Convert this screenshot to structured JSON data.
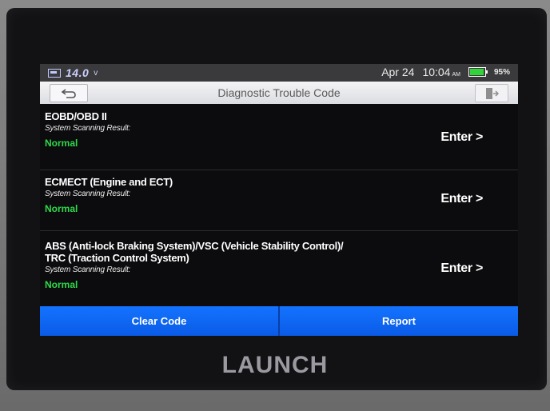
{
  "status_bar": {
    "voltage": "14.0",
    "voltage_unit": "v",
    "date": "Apr 24",
    "time": "10:04",
    "ampm": "AM",
    "battery_percent": "95%",
    "battery_color": "#33d33a"
  },
  "header": {
    "title": "Diagnostic Trouble Code",
    "back_icon": "back-arrow-icon",
    "exit_icon": "exit-door-icon"
  },
  "systems": [
    {
      "name_lines": [
        "EOBD/OBD II"
      ],
      "scan_label": "System Scanning Result:",
      "result": "Normal",
      "action": "Enter >"
    },
    {
      "name_lines": [
        "ECMECT (Engine and ECT)"
      ],
      "scan_label": "System Scanning Result:",
      "result": "Normal",
      "action": "Enter >"
    },
    {
      "name_lines": [
        "ABS (Anti-lock Braking System)/VSC (Vehicle Stability Control)/",
        "TRC (Traction Control System)"
      ],
      "scan_label": "System Scanning Result:",
      "result": "Normal",
      "action": "Enter >"
    }
  ],
  "footer": {
    "clear_code_label": "Clear Code",
    "report_label": "Report",
    "accent_color": "#1473ff"
  },
  "device": {
    "brand": "LAUNCH"
  }
}
